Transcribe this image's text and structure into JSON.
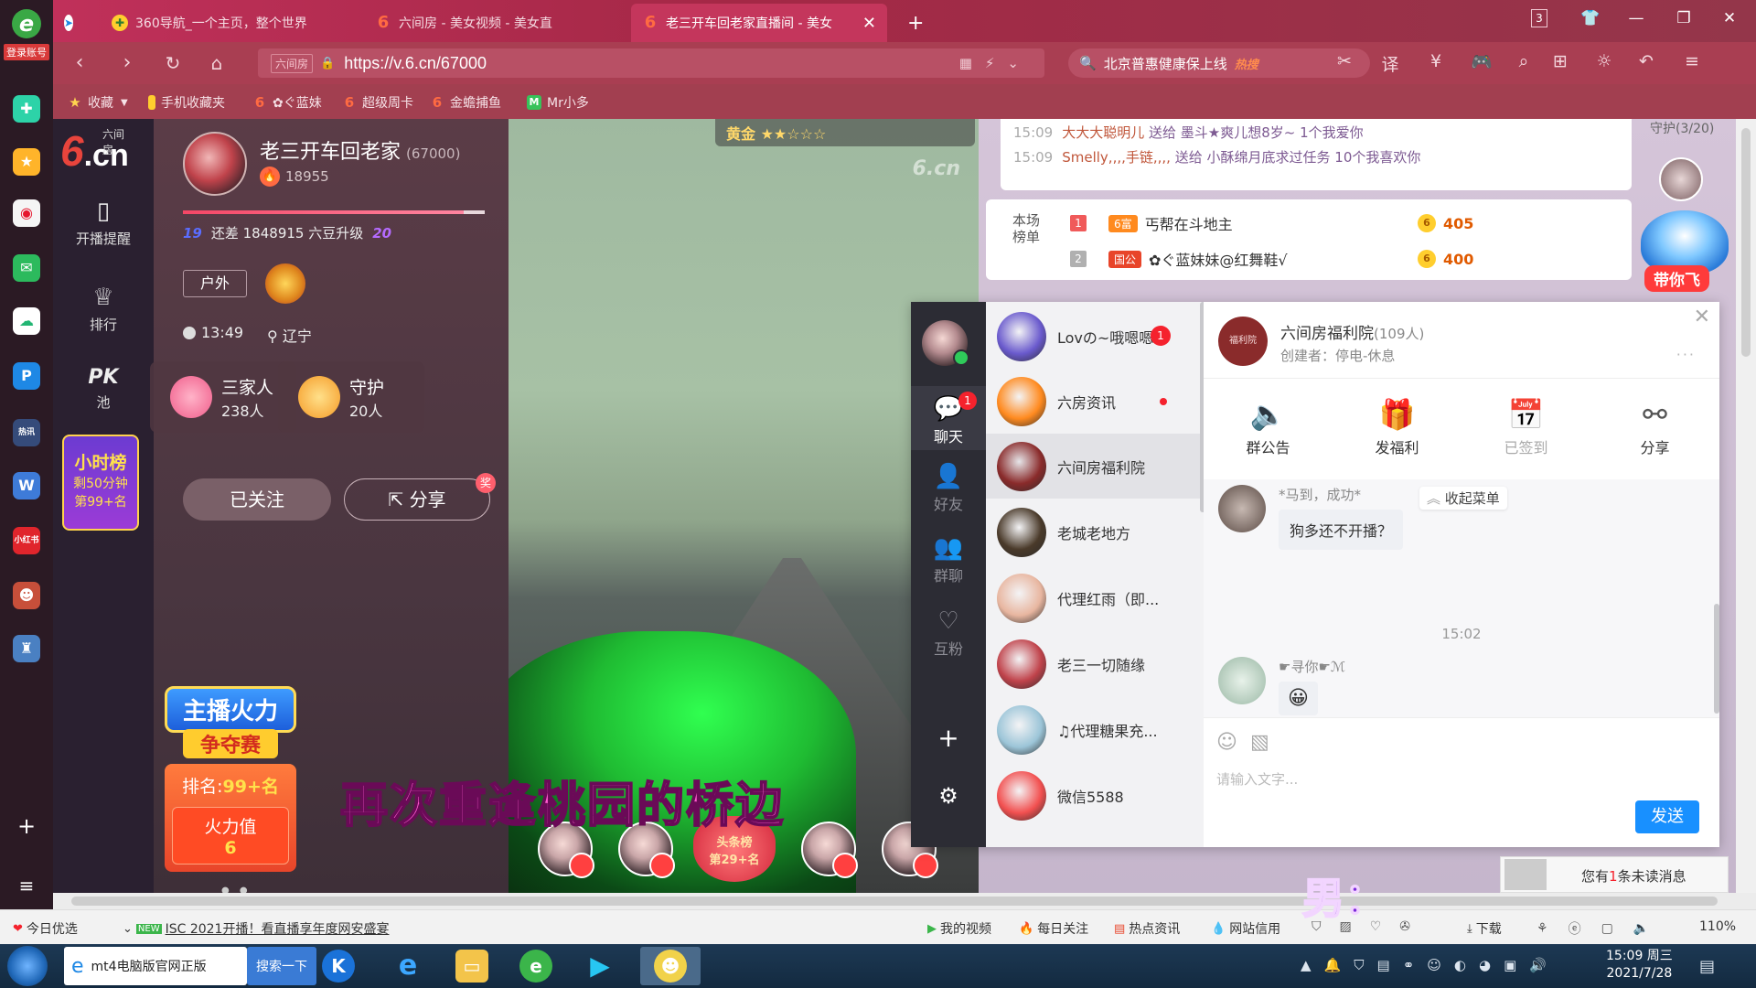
{
  "browser": {
    "login_label": "登录账号",
    "tabs": [
      {
        "title": "360导航_一个主页，整个世界"
      },
      {
        "title": "六间房 - 美女视频 - 美女直"
      },
      {
        "title": "老三开车回老家直播间 - 美女"
      }
    ],
    "tab_counter": "3",
    "url": "https://v.6.cn/67000",
    "site_tag": "六间房",
    "search_text": "北京普惠健康保上线",
    "search_hot": "热搜",
    "bookmarks": [
      "收藏",
      "手机收藏夹",
      "✿ぐ蓝妹",
      "超级周卡",
      "金蟾捕鱼",
      "Mr小多"
    ]
  },
  "site_nav": {
    "logo_tag": "六间房",
    "logo_six": "6",
    "logo_cn": ".cn",
    "items": [
      {
        "label": "开播提醒"
      },
      {
        "label": "排行"
      },
      {
        "label": "池"
      }
    ],
    "pk_label": "PK",
    "hour_board_title": "小时榜",
    "hour_board_time": "剩50分钟",
    "hour_board_rank": "第99+名"
  },
  "anchor": {
    "name": "老三开车回老家",
    "room_id": "(67000)",
    "fans": "18955",
    "level_from": "19",
    "level_text": "还差 1848915 六豆升级",
    "level_to": "20",
    "level_progress": 0.93,
    "tag": "户外",
    "time": "13:49",
    "location": "辽宁",
    "family_name": "三家人",
    "family_count": "238人",
    "guard_name": "守护",
    "guard_count": "20人",
    "follow_label": "已关注",
    "share_label": "分享",
    "share_badge": "奖",
    "fire_title": "主播火力",
    "fire_sub": "争夺赛",
    "fire_rank_label": "排名:",
    "fire_rank_value": "99+名",
    "fire_value_label": "火力值",
    "fire_value": "6"
  },
  "video": {
    "watermark": "6.cn",
    "gold_label": "黄金 ★★☆☆☆",
    "lyric": "再次重逢桃园的桥边",
    "toplist": "头条榜",
    "toplist_rank": "第29+名"
  },
  "room_chat": {
    "lines": [
      {
        "time": "15:09",
        "user": "大大大聪明儿",
        "text": "送给 墨斗★爽儿想8岁~ 1个我爱你"
      },
      {
        "time": "15:09",
        "user": "Smelly,,,,手链,,,,",
        "text": "送给 小酥绵月底求过任务 10个我喜欢你"
      }
    ],
    "rank_label": "本场榜单",
    "ranks": [
      {
        "no": "1",
        "tag": "6富",
        "name": "丐帮在斗地主",
        "score": "405",
        "color": "#f05a5a"
      },
      {
        "no": "2",
        "tag": "国公",
        "name": "✿ぐ蓝妹妹@红舞鞋√",
        "score": "400",
        "color": "#b0b0b0"
      }
    ],
    "guard_title": "守护(3/20)",
    "plane_label": "带你飞"
  },
  "chat_window": {
    "nav": [
      {
        "label": "聊天",
        "badge": "1"
      },
      {
        "label": "好友"
      },
      {
        "label": "群聊"
      },
      {
        "label": "互粉"
      }
    ],
    "conversations": [
      {
        "name": "Lovの~哦嗯嗯",
        "badge": "1",
        "color": "#6a5acd"
      },
      {
        "name": "六房资讯",
        "dot": true,
        "color": "#ff8a1f"
      },
      {
        "name": "六间房福利院",
        "color": "#8a2b2b"
      },
      {
        "name": "老城老地方",
        "color": "#4a3a2a"
      },
      {
        "name": "代理红雨（即...",
        "color": "#e8b6a0"
      },
      {
        "name": "老三一切随缘",
        "color": "#c0434b"
      },
      {
        "name": "♫代理糖果充...",
        "color": "#9cc5d8"
      },
      {
        "name": "微信5588",
        "color": "#f25050"
      }
    ],
    "group_name": "六间房福利院",
    "group_count": "(109人)",
    "group_creator": "创建者：停电-休息",
    "group_avatar_text": "福利院",
    "actions": [
      {
        "label": "群公告",
        "icon": "speaker-icon"
      },
      {
        "label": "发福利",
        "icon": "gift-icon"
      },
      {
        "label": "已签到",
        "icon": "calendar-icon",
        "disabled": true
      },
      {
        "label": "分享",
        "icon": "share-icon"
      }
    ],
    "collapse_label": "收起菜单",
    "messages": [
      {
        "nick": "*马到，成功*",
        "text": "狗多还不开播？"
      },
      {
        "nick": "☛寻你☛ℳ",
        "text": "😀"
      }
    ],
    "time_sep": "15:02",
    "input_placeholder": "请输入文字...",
    "send_label": "发送"
  },
  "overlays": {
    "notif_prefix": "您有",
    "notif_count": "1",
    "notif_suffix": "条未读消息",
    "male_label": "男："
  },
  "status_bar": {
    "left": "今日优选",
    "news_badge": "NEW",
    "news": "ISC 2021开播！看直播享年度网安盛宴",
    "items": [
      "我的视频",
      "每日关注",
      "热点资讯",
      "网站信用"
    ],
    "download": "下载",
    "zoom": "110%"
  },
  "taskbar": {
    "apps": [
      {
        "label": "mt4电脑版官网正版"
      },
      {
        "label": "搜索一下"
      }
    ],
    "time": "15:09 周三",
    "date": "2021/7/28"
  }
}
